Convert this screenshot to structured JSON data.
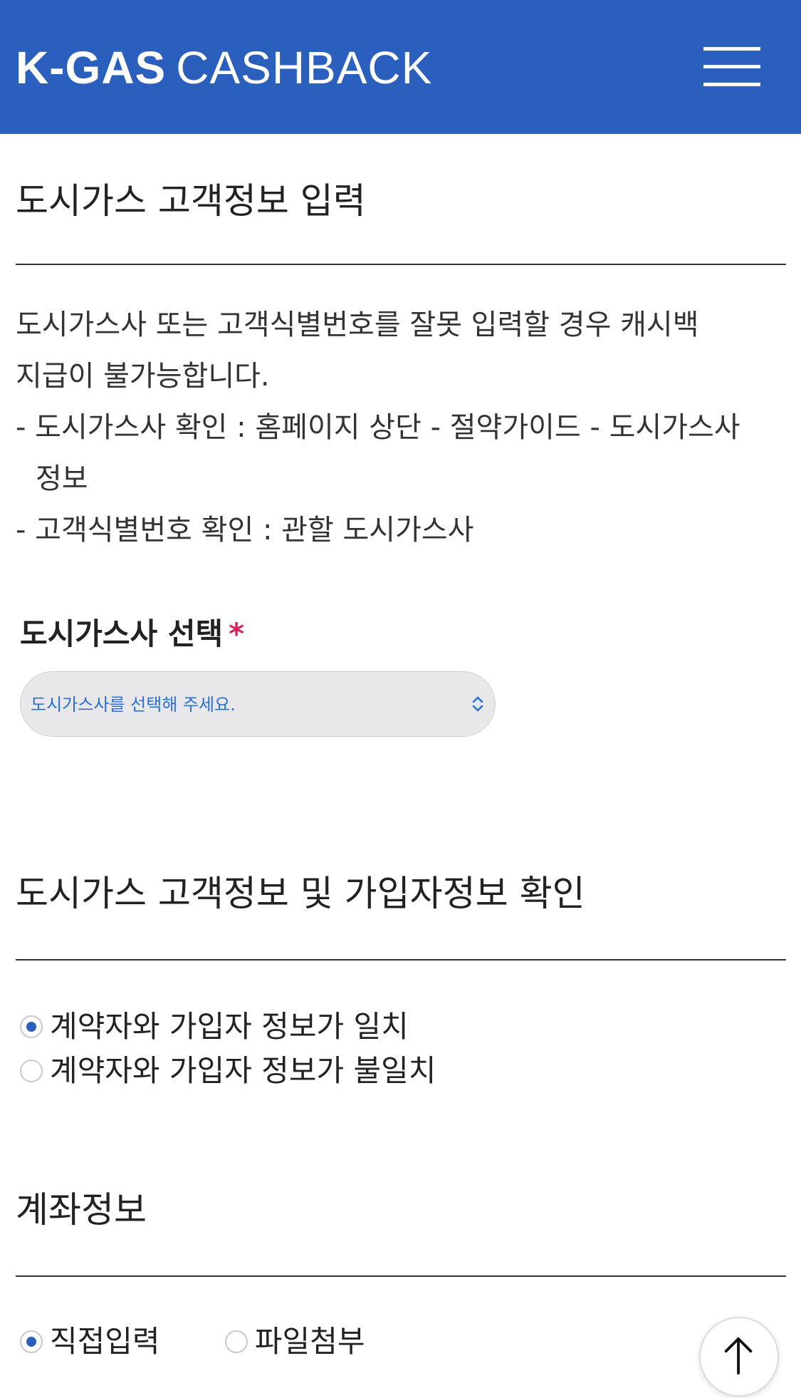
{
  "header": {
    "brand_bold": "K-GAS",
    "brand_light": "CASHBACK",
    "menu_icon": "hamburger-menu-icon",
    "bg_color": "#2b5fbd"
  },
  "section1": {
    "title": "도시가스 고객정보 입력",
    "notice": [
      "도시가스사 또는 고객식별번호를 잘못 입력할 경우 캐시백",
      "지급이 불가능합니다.",
      "- 도시가스사 확인 : 홈페이지 상단 - 절약가이드 - 도시가스사",
      "정보",
      "- 고객식별번호 확인 : 관할 도시가스사"
    ],
    "select_label": "도시가스사 선택",
    "required_mark": "*",
    "select_value": "도시가스사를 선택해 주세요.",
    "required_color": "#d6245b"
  },
  "section2": {
    "title": "도시가스 고객정보 및 가입자정보 확인",
    "options": [
      {
        "label": "계약자와 가입자 정보가 일치",
        "checked": true
      },
      {
        "label": "계약자와 가입자 정보가 불일치",
        "checked": false
      }
    ]
  },
  "section3": {
    "title": "계좌정보",
    "options": [
      {
        "label": "직접입력",
        "checked": true
      },
      {
        "label": "파일첨부",
        "checked": false
      }
    ]
  },
  "scroll_top_icon": "arrow-up-icon"
}
